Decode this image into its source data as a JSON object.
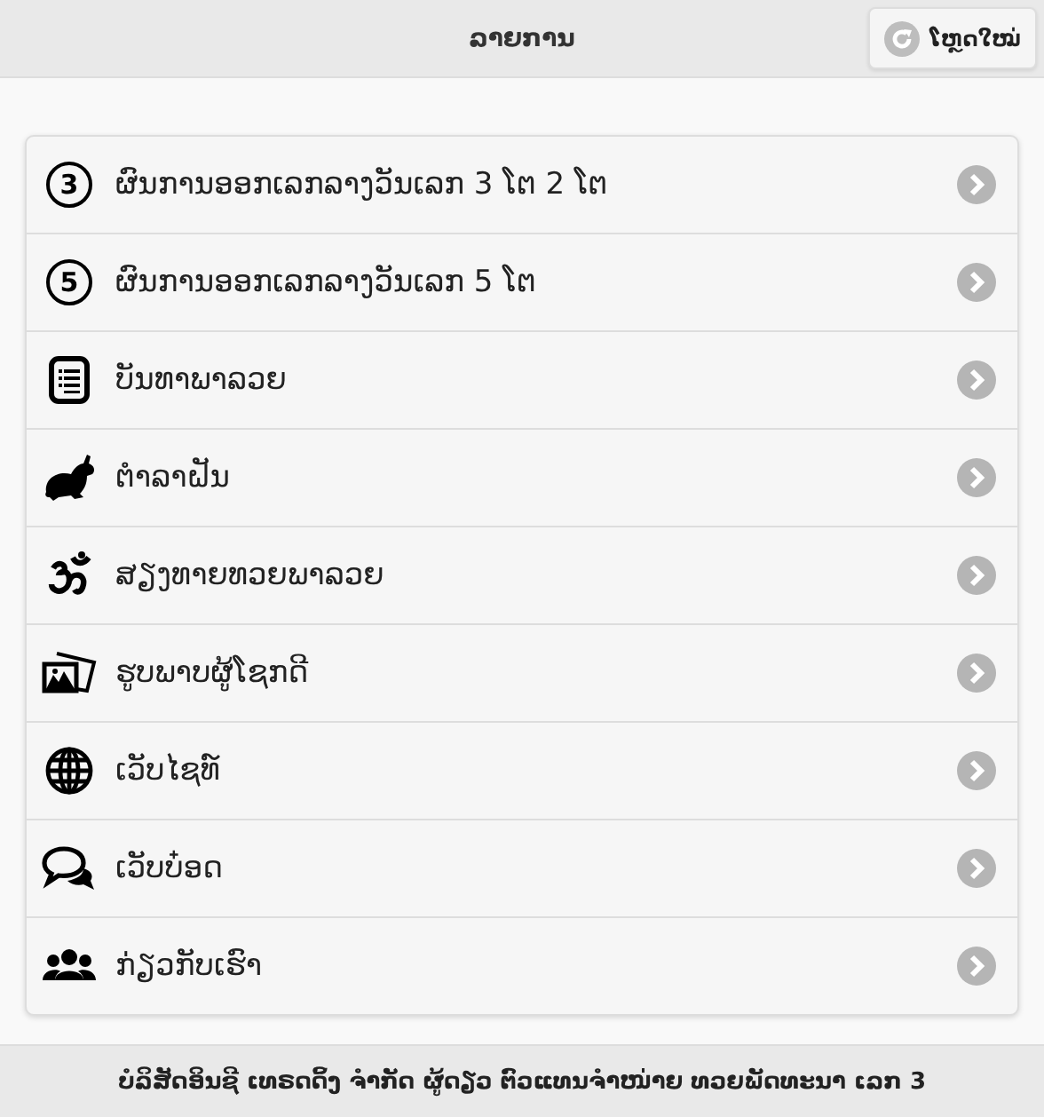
{
  "header": {
    "title": "ລາຍການ",
    "reload_button": "ໂຫຼດໃໝ່"
  },
  "items": [
    {
      "kind": "number",
      "badge": "3",
      "label": "ຜົນການອອກເລກລາງວັນເລກ 3 ໂຕ 2 ໂຕ"
    },
    {
      "kind": "number",
      "badge": "5",
      "label": "ຜົນການອອກເລກລາງວັນເລກ 5 ໂຕ"
    },
    {
      "kind": "list",
      "label": "ບັນທາພາລວຍ"
    },
    {
      "kind": "rabbit",
      "label": "ຕຳລາຝັນ"
    },
    {
      "kind": "om",
      "label": "ສຽງທາຍທວຍພາລວຍ"
    },
    {
      "kind": "photo",
      "label": "ຮູບພາບຜູ້ໂຊກດີ"
    },
    {
      "kind": "globe",
      "label": "ເວັບໄຊທ໌"
    },
    {
      "kind": "chat",
      "label": "ເວັບບ໋ອດ"
    },
    {
      "kind": "group",
      "label": "ກ່ຽວກັບເຮົາ"
    }
  ],
  "footer": "ບໍລິສັດອິນຊີ ເທຣດດິ້ງ ຈຳກັດ ຜູ້ດຽວ ຕົວແທນຈຳໜ່າຍ ທວຍພັດທະນາ ເລກ 3"
}
